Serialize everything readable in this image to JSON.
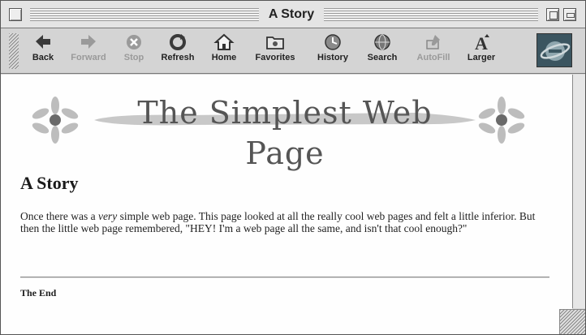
{
  "window": {
    "title": "A Story"
  },
  "toolbar": {
    "buttons": [
      {
        "label": "Back",
        "icon": "back-arrow-icon",
        "enabled": true
      },
      {
        "label": "Forward",
        "icon": "forward-arrow-icon",
        "enabled": false
      },
      {
        "label": "Stop",
        "icon": "stop-icon",
        "enabled": false
      },
      {
        "label": "Refresh",
        "icon": "refresh-icon",
        "enabled": true
      },
      {
        "label": "Home",
        "icon": "home-icon",
        "enabled": true
      },
      {
        "label": "Favorites",
        "icon": "favorites-folder-icon",
        "enabled": true
      },
      {
        "label": "History",
        "icon": "history-icon",
        "enabled": true
      },
      {
        "label": "Search",
        "icon": "search-icon",
        "enabled": true
      },
      {
        "label": "AutoFill",
        "icon": "autofill-icon",
        "enabled": false
      },
      {
        "label": "Larger",
        "icon": "larger-text-icon",
        "enabled": true
      }
    ]
  },
  "page": {
    "banner_title": "The Simplest Web Page",
    "heading": "A Story",
    "body_part1": "Once there was a ",
    "body_emphasis": "very",
    "body_part2": " simple web page. This page looked at all the really cool web pages and felt a little inferior. But then the little web page remembered, \"HEY! I'm a web page all the same, and isn't that cool enough?\"",
    "footer": "The End"
  },
  "colors": {
    "chrome": "#d4d4d4",
    "content_bg": "#fefefe",
    "banner_text": "#555555",
    "brush_stroke": "#c8c8c8",
    "flower": "#bdbdbd",
    "flower_center": "#6a6a6a"
  }
}
